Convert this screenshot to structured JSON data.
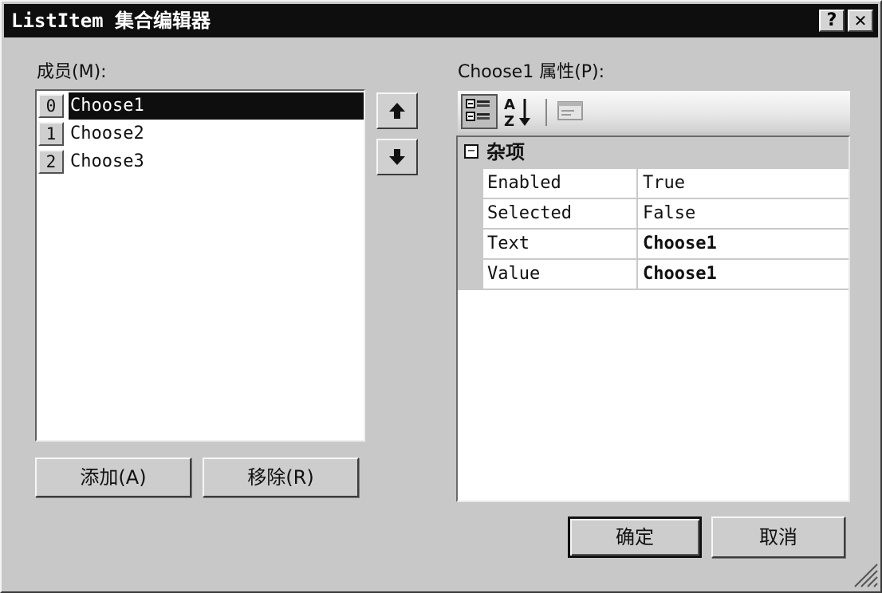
{
  "window": {
    "title": "ListItem 集合编辑器",
    "help_label": "?",
    "close_label": "✕"
  },
  "members": {
    "label": "成员(M):",
    "items": [
      {
        "index": "0",
        "name": "Choose1",
        "selected": true
      },
      {
        "index": "1",
        "name": "Choose2",
        "selected": false
      },
      {
        "index": "2",
        "name": "Choose3",
        "selected": false
      }
    ],
    "move_up_icon": "arrow-up-icon",
    "move_down_icon": "arrow-down-icon",
    "add_label": "添加(A)",
    "remove_label": "移除(R)"
  },
  "properties": {
    "label": "Choose1 属性(P):",
    "toolbar": {
      "categorized_icon": "categorized-icon",
      "alphabetical_icon": "alphabetical-sort-icon",
      "alphabetical_text": "A Z",
      "property_pages_icon": "property-pages-icon"
    },
    "category": {
      "toggle": "⊟",
      "name": "杂项"
    },
    "rows": [
      {
        "name": "Enabled",
        "value": "True"
      },
      {
        "name": "Selected",
        "value": "False"
      },
      {
        "name": "Text",
        "value": "Choose1"
      },
      {
        "name": "Value",
        "value": "Choose1"
      }
    ]
  },
  "footer": {
    "ok_label": "确定",
    "cancel_label": "取消",
    "resize_grip_icon": "resize-grip-icon"
  }
}
